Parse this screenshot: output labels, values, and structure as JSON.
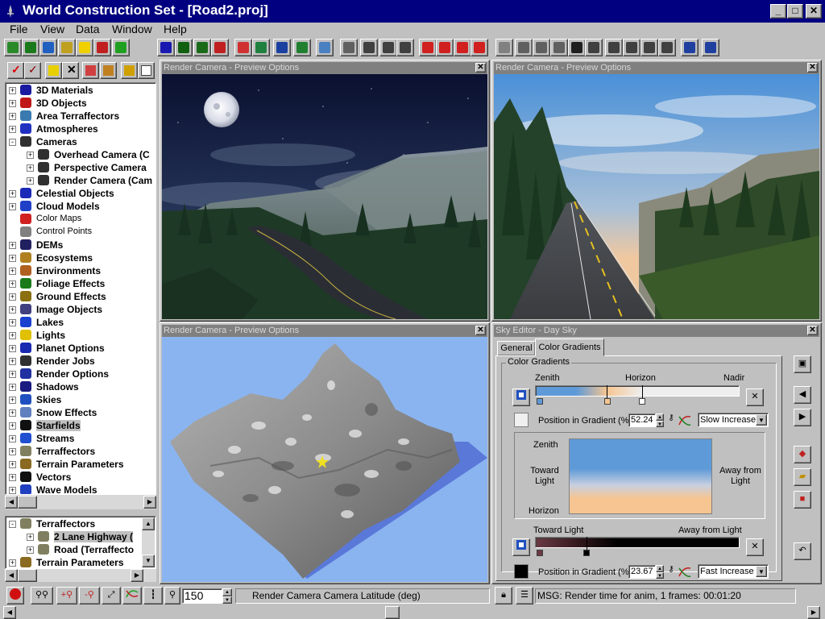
{
  "window": {
    "title": "World Construction Set - [Road2.proj]"
  },
  "menu": [
    "File",
    "View",
    "Data",
    "Window",
    "Help"
  ],
  "tree": {
    "items": [
      {
        "label": "3D Materials",
        "icon": "materials-icon",
        "color": "#1a1aa0",
        "depth": 0,
        "expander": "+"
      },
      {
        "label": "3D Objects",
        "icon": "car-icon",
        "color": "#c01818",
        "depth": 0,
        "expander": "+"
      },
      {
        "label": "Area Terraffectors",
        "icon": "terraffector-icon",
        "color": "#3a7ab0",
        "depth": 0,
        "expander": "+"
      },
      {
        "label": "Atmospheres",
        "icon": "atmosphere-icon",
        "color": "#2030c0",
        "depth": 0,
        "expander": "+"
      },
      {
        "label": "Cameras",
        "icon": "camera-icon",
        "color": "#303030",
        "depth": 0,
        "expander": "-"
      },
      {
        "label": "Overhead Camera (C",
        "icon": "camera-icon",
        "color": "#303030",
        "depth": 1,
        "expander": "+"
      },
      {
        "label": "Perspective Camera",
        "icon": "camera-icon",
        "color": "#303030",
        "depth": 1,
        "expander": "+"
      },
      {
        "label": "Render Camera (Cam",
        "icon": "camera-icon",
        "color": "#303030",
        "depth": 1,
        "expander": "+"
      },
      {
        "label": "Celestial Objects",
        "icon": "celestial-icon",
        "color": "#1c2ab8",
        "depth": 0,
        "expander": "+"
      },
      {
        "label": "Cloud Models",
        "icon": "cloud-icon",
        "color": "#2040c8",
        "depth": 0,
        "expander": "+"
      },
      {
        "label": "Color Maps",
        "icon": "color-map-icon",
        "color": "#d02020",
        "depth": 0,
        "expander": "",
        "plain": true
      },
      {
        "label": "Control Points",
        "icon": "control-points-icon",
        "color": "#808080",
        "depth": 0,
        "expander": "",
        "plain": true
      },
      {
        "label": "DEMs",
        "icon": "dem-icon",
        "color": "#202060",
        "depth": 0,
        "expander": "+"
      },
      {
        "label": "Ecosystems",
        "icon": "ecosystem-icon",
        "color": "#b08020",
        "depth": 0,
        "expander": "+"
      },
      {
        "label": "Environments",
        "icon": "environment-icon",
        "color": "#b06020",
        "depth": 0,
        "expander": "+"
      },
      {
        "label": "Foliage Effects",
        "icon": "foliage-icon",
        "color": "#1a7a1a",
        "depth": 0,
        "expander": "+"
      },
      {
        "label": "Ground Effects",
        "icon": "ground-icon",
        "color": "#8a7010",
        "depth": 0,
        "expander": "+"
      },
      {
        "label": "Image Objects",
        "icon": "image-object-icon",
        "color": "#404080",
        "depth": 0,
        "expander": "+"
      },
      {
        "label": "Lakes",
        "icon": "lake-icon",
        "color": "#1a40d0",
        "depth": 0,
        "expander": "+"
      },
      {
        "label": "Lights",
        "icon": "light-icon",
        "color": "#e0c000",
        "depth": 0,
        "expander": "+"
      },
      {
        "label": "Planet Options",
        "icon": "planet-icon",
        "color": "#1a2ab0",
        "depth": 0,
        "expander": "+"
      },
      {
        "label": "Render Jobs",
        "icon": "render-job-icon",
        "color": "#303030",
        "depth": 0,
        "expander": "+"
      },
      {
        "label": "Render Options",
        "icon": "render-options-icon",
        "color": "#2030a0",
        "depth": 0,
        "expander": "+"
      },
      {
        "label": "Shadows",
        "icon": "shadow-icon",
        "color": "#1a1a80",
        "depth": 0,
        "expander": "+"
      },
      {
        "label": "Skies",
        "icon": "sky-icon",
        "color": "#2050c0",
        "depth": 0,
        "expander": "+"
      },
      {
        "label": "Snow Effects",
        "icon": "snow-icon",
        "color": "#6080c0",
        "depth": 0,
        "expander": "+"
      },
      {
        "label": "Starfields",
        "icon": "starfield-icon",
        "color": "#101010",
        "depth": 0,
        "expander": "+",
        "selected": true
      },
      {
        "label": "Streams",
        "icon": "stream-icon",
        "color": "#2050d0",
        "depth": 0,
        "expander": "+"
      },
      {
        "label": "Terraffectors",
        "icon": "terraffector-icon",
        "color": "#808060",
        "depth": 0,
        "expander": "+"
      },
      {
        "label": "Terrain Parameters",
        "icon": "terrain-icon",
        "color": "#8a6a20",
        "depth": 0,
        "expander": "+"
      },
      {
        "label": "Vectors",
        "icon": "vector-icon",
        "color": "#101010",
        "depth": 0,
        "expander": "+"
      },
      {
        "label": "Wave Models",
        "icon": "wave-icon",
        "color": "#2040c0",
        "depth": 0,
        "expander": "+"
      }
    ]
  },
  "tree2": {
    "items": [
      {
        "label": "Terraffectors",
        "icon": "terraffector-icon",
        "color": "#808060",
        "depth": 0,
        "expander": "-"
      },
      {
        "label": "2 Lane Highway (",
        "icon": "road-icon",
        "color": "#808060",
        "depth": 1,
        "expander": "+",
        "selected": true
      },
      {
        "label": "Road (Terraffecto",
        "icon": "road-icon",
        "color": "#808060",
        "depth": 1,
        "expander": "+"
      },
      {
        "label": "Terrain Parameters",
        "icon": "terrain-icon",
        "color": "#8a6a20",
        "depth": 0,
        "expander": "+"
      }
    ]
  },
  "views": {
    "tl": {
      "title": "Render Camera - Preview Options"
    },
    "tr": {
      "title": "Render Camera - Preview Options"
    },
    "bl": {
      "title": "Render Camera - Preview Options"
    }
  },
  "sky_editor": {
    "title": "Sky Editor - Day Sky",
    "tabs": {
      "general": "General",
      "color_gradients": "Color Gradients"
    },
    "group_label": "Color Gradients",
    "gradient1": {
      "labels": {
        "left": "Zenith",
        "middle": "Horizon",
        "right": "Nadir"
      },
      "position_label": "Position in Gradient (%)",
      "position_value": "52.24",
      "mode": "Slow Increase",
      "colors": {
        "start": "#5f9ad8",
        "mid": "#f6c591",
        "end": "#eeeeee"
      }
    },
    "preview": {
      "zenith": "Zenith",
      "toward": "Toward Light",
      "away": "Away from Light",
      "horizon": "Horizon"
    },
    "gradient2": {
      "labels": {
        "left": "Toward Light",
        "right": "Away from Light"
      },
      "position_label": "Position in Gradient (%)",
      "position_value": "23.67",
      "mode": "Fast Increase",
      "colors": {
        "start": "#6b3a44",
        "end": "#000000"
      }
    }
  },
  "status": {
    "frame_value": "150",
    "field_label": "Render Camera Camera Latitude (deg)",
    "message": "MSG: Render time for anim, 1 frames:  00:01:20"
  }
}
